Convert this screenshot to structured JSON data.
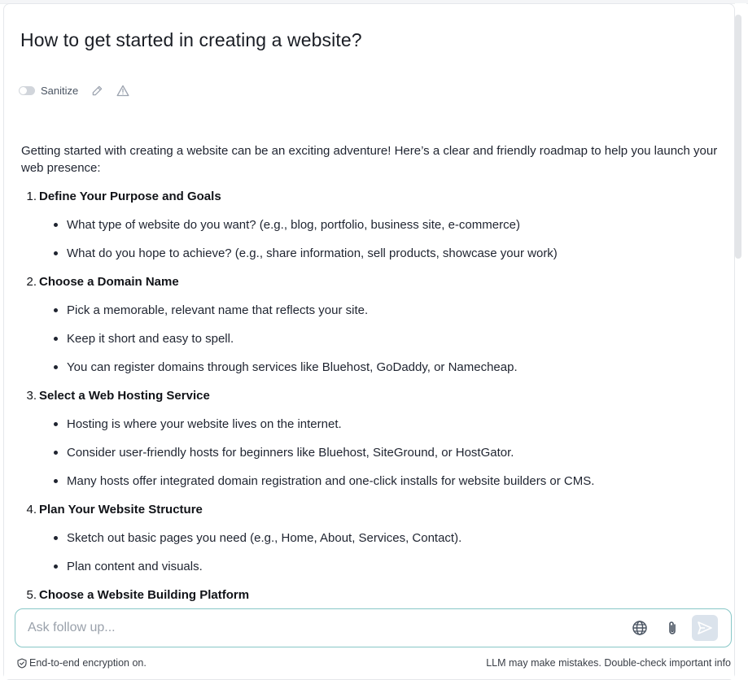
{
  "title": "How to get started in creating a website?",
  "toolbar": {
    "sanitize_label": "Sanitize",
    "sanitize_on": false,
    "edit_icon": "pencil-icon",
    "warning_icon": "warning-triangle-icon"
  },
  "message": {
    "intro": "Getting started with creating a website can be an exciting adventure! Here’s a clear and friendly roadmap to help you launch your web presence:",
    "steps": [
      {
        "number": "1.",
        "title": "Define Your Purpose and Goals",
        "bullets": [
          "What type of website do you want? (e.g., blog, portfolio, business site, e-commerce)",
          "What do you hope to achieve? (e.g., share information, sell products, showcase your work)"
        ]
      },
      {
        "number": "2.",
        "title": "Choose a Domain Name",
        "bullets": [
          "Pick a memorable, relevant name that reflects your site.",
          "Keep it short and easy to spell.",
          "You can register domains through services like Bluehost, GoDaddy, or Namecheap."
        ]
      },
      {
        "number": "3.",
        "title": "Select a Web Hosting Service",
        "bullets": [
          "Hosting is where your website lives on the internet.",
          "Consider user-friendly hosts for beginners like Bluehost, SiteGround, or HostGator.",
          "Many hosts offer integrated domain registration and one-click installs for website builders or CMS."
        ]
      },
      {
        "number": "4.",
        "title": "Plan Your Website Structure",
        "bullets": [
          "Sketch out basic pages you need (e.g., Home, About, Services, Contact).",
          "Plan content and visuals."
        ]
      },
      {
        "number": "5.",
        "title": "Choose a Website Building Platform",
        "bullets": []
      }
    ]
  },
  "composer": {
    "placeholder": "Ask follow up...",
    "value": "",
    "globe_icon": "globe-icon",
    "attach_icon": "paperclip-icon",
    "send_icon": "send-icon"
  },
  "footer": {
    "encryption_text": "End-to-end encryption on.",
    "disclaimer": "LLM may make mistakes. Double-check important info"
  },
  "colors": {
    "input_border": "#88c7c7",
    "send_button_bg": "#dbe3ec",
    "toggle_off": "#d1d5db",
    "text": "#1f2430"
  }
}
